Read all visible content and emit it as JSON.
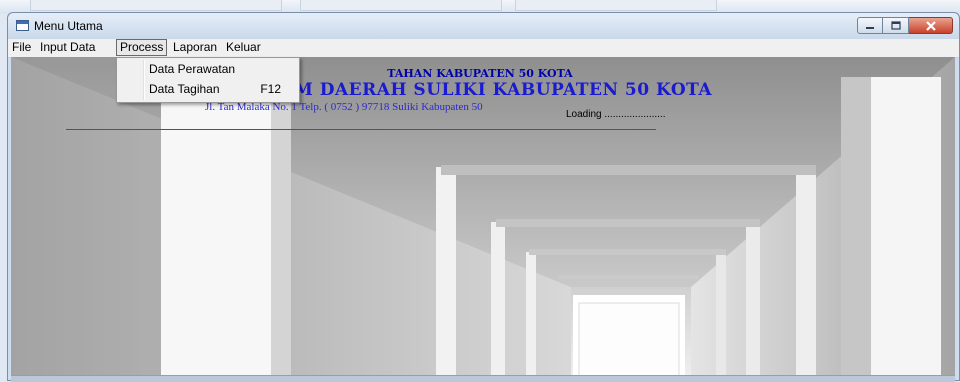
{
  "window": {
    "title": "Menu Utama"
  },
  "menubar": {
    "items": [
      "File",
      "Input Data",
      "Process",
      "Laporan",
      "Keluar"
    ]
  },
  "process_menu": {
    "items": [
      {
        "label": "Data Perawatan",
        "shortcut": ""
      },
      {
        "label": "Data Tagihan",
        "shortcut": "F12"
      }
    ]
  },
  "header": {
    "line1": "TAHAN KABUPATEN 50 KOTA",
    "line2": "M DAERAH SULIKI KABUPATEN 50 KOTA",
    "address": "Jl. Tan Malaka No. 1 Telp. ( 0752 ) 97718 Suliki Kabupaten 50",
    "loading": "Loading ......................"
  },
  "colors": {
    "header_text": "#1a1ad0",
    "rule": "#4646c8"
  },
  "icons": {
    "app": "window-app-icon",
    "minimize": "minimize-icon",
    "maximize": "maximize-icon",
    "close": "close-icon"
  }
}
